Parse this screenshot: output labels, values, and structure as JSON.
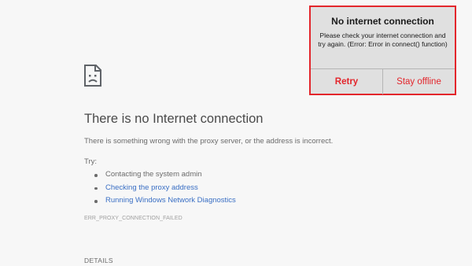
{
  "error_page": {
    "icon": "sad-page-icon",
    "headline": "There is no Internet connection",
    "subtext": "There is something wrong with the proxy server, or the address is incorrect.",
    "try_label": "Try:",
    "suggestions": [
      {
        "label": "Contacting the system admin",
        "is_link": false
      },
      {
        "label": "Checking the proxy address",
        "is_link": true
      },
      {
        "label": "Running Windows Network Diagnostics",
        "is_link": true
      }
    ],
    "error_code": "ERR_PROXY_CONNECTION_FAILED",
    "details_label": "DETAILS"
  },
  "dialog": {
    "title": "No internet connection",
    "message": "Please check your internet connection and try again. (Error: Error in connect() function)",
    "retry_label": "Retry",
    "stay_offline_label": "Stay offline"
  },
  "colors": {
    "page_background": "#f7f7f7",
    "link": "#3a6fc4",
    "dialog_accent": "#e3262c",
    "dialog_background": "#e0e0e0"
  }
}
